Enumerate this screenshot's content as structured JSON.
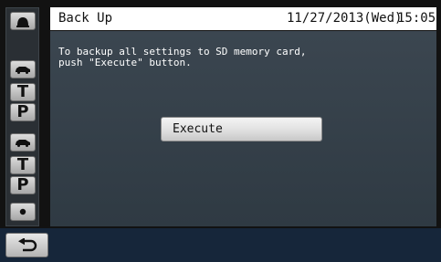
{
  "header": {
    "title": "Back Up",
    "date": "11/27/2013(Wed)",
    "time": "15:05"
  },
  "main": {
    "message": "To backup all settings to SD memory card,\npush \"Execute\" button.",
    "execute_label": "Execute"
  },
  "sidebar": {
    "items": [
      {
        "icon": "rec-camera-icon"
      },
      {
        "icon": "camera-car-icon"
      },
      {
        "icon": "letter-t-icon",
        "label": "T"
      },
      {
        "icon": "letter-p-icon",
        "label": "P"
      },
      {
        "icon": "camera-car-icon"
      },
      {
        "icon": "letter-t-icon",
        "label": "T"
      },
      {
        "icon": "letter-p-icon",
        "label": "P"
      },
      {
        "icon": "dot-icon"
      }
    ]
  },
  "footer": {
    "back_icon": "return-arrow-icon"
  },
  "colors": {
    "background": "#121212",
    "content": "#34404a",
    "bottombar": "#16263a",
    "titlebar": "#ffffff"
  }
}
